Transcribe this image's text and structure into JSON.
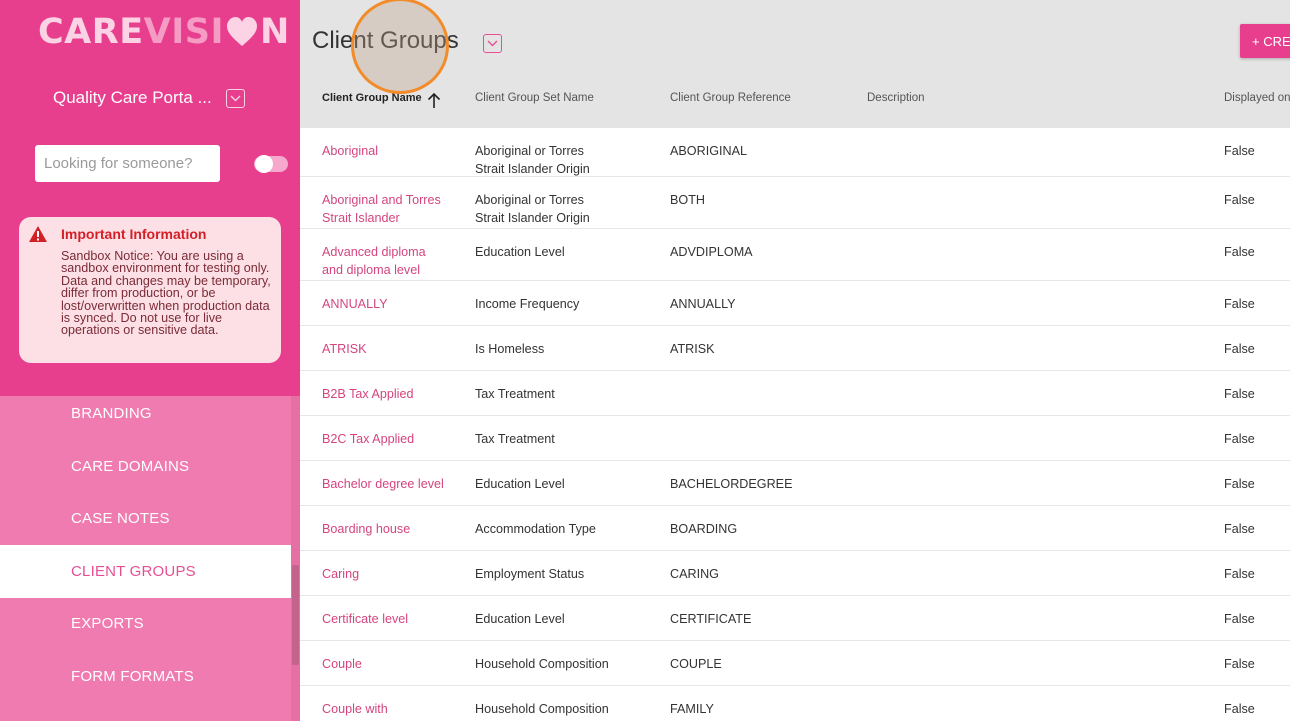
{
  "colors": {
    "brand": "#e73f8e",
    "nav_bg": "#ef7bb0",
    "link": "#d4457f",
    "warning": "#d32027"
  },
  "logo": {
    "care": "CARE",
    "vision": "VISI",
    "heart": "heart-o-icon",
    "n": "N"
  },
  "portal": {
    "name": "Quality Care Porta ...",
    "icon": "chevron-down-icon"
  },
  "search": {
    "placeholder": "Looking for someone?"
  },
  "info": {
    "title": "Important Information",
    "body": "Sandbox Notice: You are using a sandbox environment for testing only. Data and changes may be temporary, differ from production, or be lost/overwritten when production data is synced. Do not use for live operations or sensitive data.",
    "icon": "warning-icon"
  },
  "nav": {
    "items": [
      {
        "label": "BRANDING",
        "active": false
      },
      {
        "label": "CARE DOMAINS",
        "active": false
      },
      {
        "label": "CASE NOTES",
        "active": false
      },
      {
        "label": "CLIENT GROUPS",
        "active": true
      },
      {
        "label": "EXPORTS",
        "active": false
      },
      {
        "label": "FORM FORMATS",
        "active": false
      }
    ]
  },
  "header": {
    "title": "Client Groups",
    "create_label": "+ CREATE",
    "sort_icon": "arrow-up-icon"
  },
  "table": {
    "columns": [
      "Client Group Name",
      "Client Group Set Name",
      "Client Group Reference",
      "Description",
      "Displayed on"
    ],
    "rows": [
      {
        "name": "Aboriginal",
        "set": "Aboriginal or Torres Strait Islander Origin",
        "ref": "ABORIGINAL",
        "desc": "",
        "disp": "False"
      },
      {
        "name": "Aboriginal and Torres Strait Islander",
        "set": "Aboriginal or Torres Strait Islander Origin",
        "ref": "BOTH",
        "desc": "",
        "disp": "False"
      },
      {
        "name": "Advanced diploma and diploma level",
        "set": "Education Level",
        "ref": "ADVDIPLOMA",
        "desc": "",
        "disp": "False"
      },
      {
        "name": "ANNUALLY",
        "set": "Income Frequency",
        "ref": "ANNUALLY",
        "desc": "",
        "disp": "False"
      },
      {
        "name": "ATRISK",
        "set": "Is Homeless",
        "ref": "ATRISK",
        "desc": "",
        "disp": "False"
      },
      {
        "name": "B2B Tax Applied",
        "set": "Tax Treatment",
        "ref": "",
        "desc": "",
        "disp": "False"
      },
      {
        "name": "B2C Tax Applied",
        "set": "Tax Treatment",
        "ref": "",
        "desc": "",
        "disp": "False"
      },
      {
        "name": "Bachelor degree level",
        "set": "Education Level",
        "ref": "BACHELORDEGREE",
        "desc": "",
        "disp": "False"
      },
      {
        "name": "Boarding house",
        "set": "Accommodation Type",
        "ref": "BOARDING",
        "desc": "",
        "disp": "False"
      },
      {
        "name": "Caring",
        "set": "Employment Status",
        "ref": "CARING",
        "desc": "",
        "disp": "False"
      },
      {
        "name": "Certificate level",
        "set": "Education Level",
        "ref": "CERTIFICATE",
        "desc": "",
        "disp": "False"
      },
      {
        "name": "Couple",
        "set": "Household Composition",
        "ref": "COUPLE",
        "desc": "",
        "disp": "False"
      },
      {
        "name": "Couple with",
        "set": "Household Composition",
        "ref": "FAMILY",
        "desc": "",
        "disp": "False"
      }
    ]
  }
}
